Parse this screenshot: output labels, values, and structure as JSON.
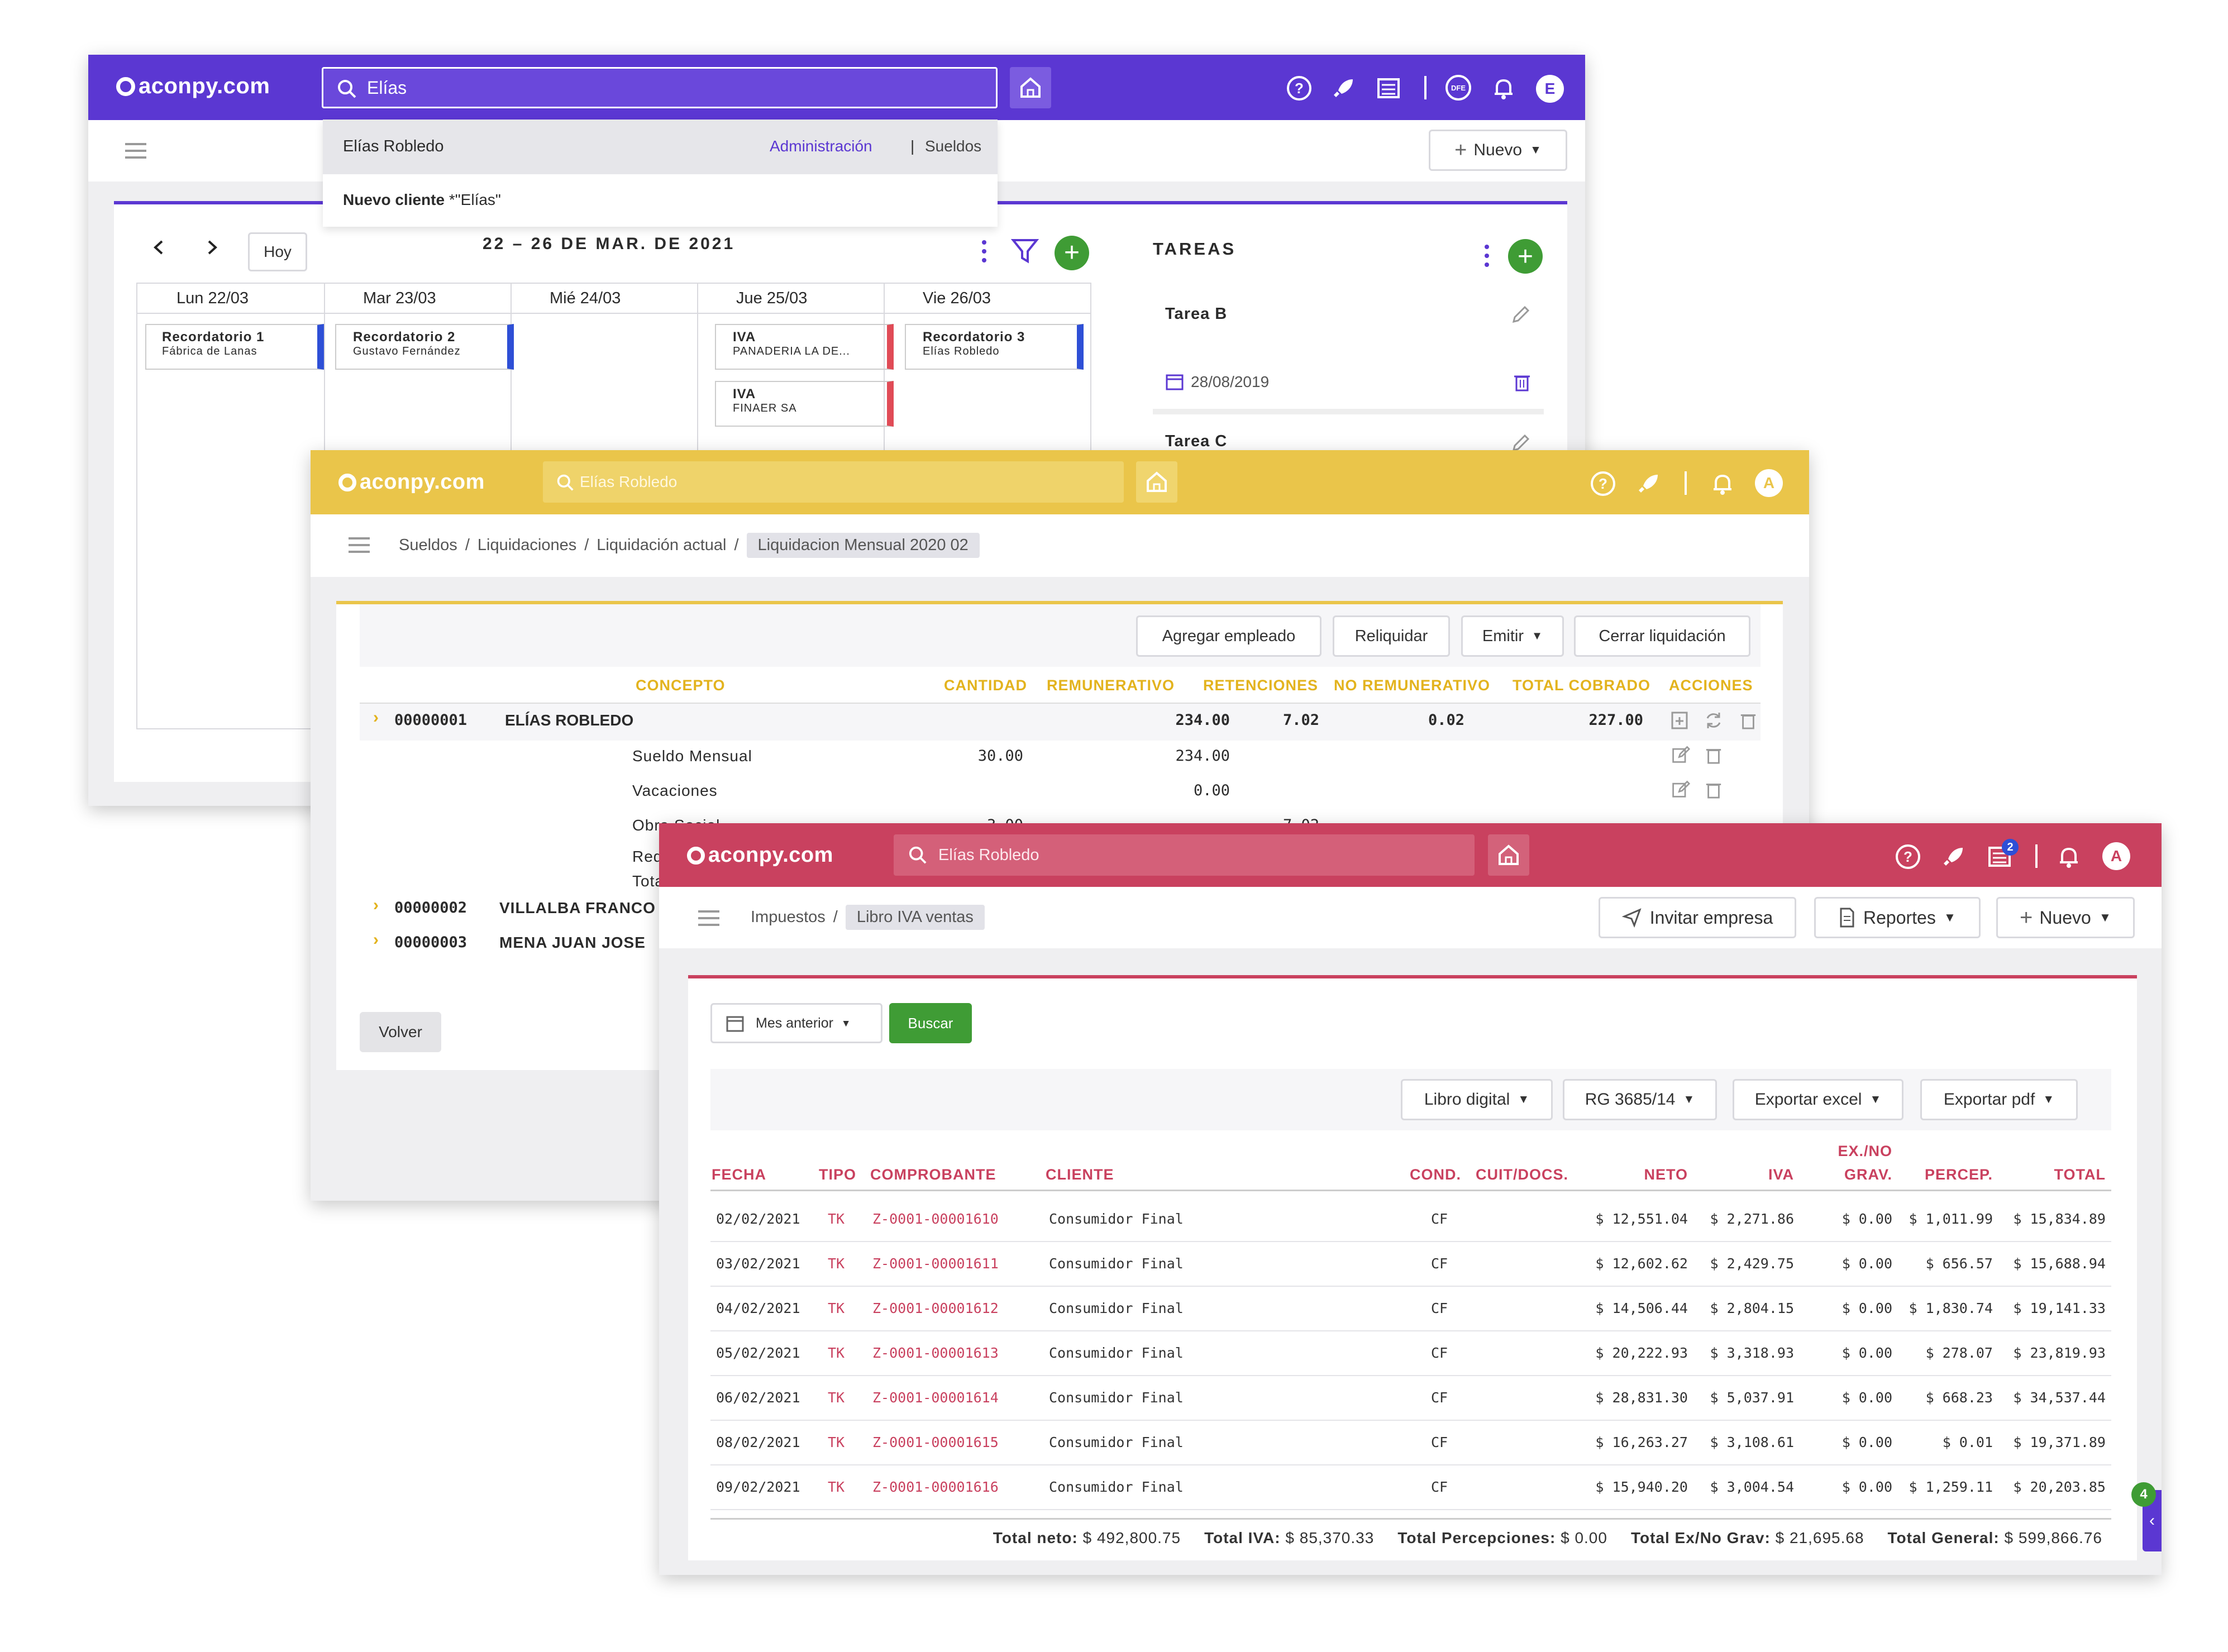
{
  "colors": {
    "purple": "#5b37d2",
    "yellow": "#eac54a",
    "crimson": "#c9415f",
    "green": "#3f9c35",
    "blue_marker": "#2e4fd6",
    "red_marker": "#e04b56",
    "link_red": "#c9415f"
  },
  "win1": {
    "logo": "aconpy.com",
    "search_value": "Elías",
    "avatar_letter": "E",
    "dfe_badge": "DFE",
    "dropdown": {
      "result_name": "Elías Robledo",
      "result_tag1": "Administración",
      "result_sep": "|",
      "result_tag2": "Sueldos",
      "new_client_bold": "Nuevo cliente",
      "new_client_rest": " *\"Elías\""
    },
    "nuevo_button": "Nuevo",
    "calendar": {
      "hoy_button": "Hoy",
      "range_title": "22 – 26 DE MAR. DE 2021",
      "days": [
        "Lun 22/03",
        "Mar 23/03",
        "Mié 24/03",
        "Jue 25/03",
        "Vie 26/03"
      ],
      "events": [
        {
          "title": "Recordatorio 1",
          "sub": "Fábrica de Lanas"
        },
        {
          "title": "Recordatorio 2",
          "sub": "Gustavo Fernández"
        },
        {
          "title": "IVA",
          "sub": "PANADERIA LA DE..."
        },
        {
          "title": "IVA",
          "sub": "FINAER SA"
        },
        {
          "title": "Recordatorio 3",
          "sub": "Elías Robledo"
        }
      ]
    },
    "tareas": {
      "title": "TAREAS",
      "task_b": "Tarea B",
      "task_b_date": "28/08/2019",
      "task_c": "Tarea C"
    }
  },
  "win2": {
    "logo": "aconpy.com",
    "search_placeholder": "Elías Robledo",
    "avatar_letter": "A",
    "breadcrumb": [
      "Sueldos",
      "Liquidaciones",
      "Liquidación actual"
    ],
    "breadcrumb_sep": "/",
    "breadcrumb_current": "Liquidacion Mensual 2020 02",
    "buttons": {
      "agregar": "Agregar empleado",
      "reliquidar": "Reliquidar",
      "emitir": "Emitir",
      "cerrar": "Cerrar liquidación",
      "volver": "Volver"
    },
    "columns": [
      "CONCEPTO",
      "CANTIDAD",
      "REMUNERATIVO",
      "RETENCIONES",
      "NO REMUNERATIVO",
      "TOTAL COBRADO",
      "ACCIONES"
    ],
    "employee1": {
      "code": "00000001",
      "name": "ELÍAS ROBLEDO",
      "remunerativo": "234.00",
      "retenciones": "7.02",
      "no_rem": "0.02",
      "total": "227.00"
    },
    "concepts": [
      {
        "name": "Sueldo Mensual",
        "cantidad": "30.00",
        "remunerativo": "234.00",
        "retenciones": ""
      },
      {
        "name": "Vacaciones",
        "cantidad": "",
        "remunerativo": "0.00",
        "retenciones": ""
      },
      {
        "name": "Obra Social",
        "cantidad": "3.00",
        "remunerativo": "",
        "retenciones": "7.02"
      },
      {
        "name": "Red",
        "cantidad": "",
        "remunerativo": "",
        "retenciones": ""
      },
      {
        "name": "Tota",
        "cantidad": "",
        "remunerativo": "",
        "retenciones": ""
      }
    ],
    "employee2": {
      "code": "00000002",
      "name": "VILLALBA FRANCO"
    },
    "employee3": {
      "code": "00000003",
      "name": "MENA JUAN JOSE"
    }
  },
  "win3": {
    "logo": "aconpy.com",
    "search_placeholder": "Elías Robledo",
    "avatar_letter": "A",
    "notif_count": "2",
    "breadcrumb_root": "Impuestos",
    "breadcrumb_sep": "/",
    "breadcrumb_current": "Libro IVA ventas",
    "top_buttons": {
      "invitar": "Invitar empresa",
      "reportes": "Reportes",
      "nuevo": "Nuevo"
    },
    "period_select": "Mes anterior",
    "buscar_button": "Buscar",
    "toolbar": {
      "libro": "Libro digital",
      "rg": "RG 3685/14",
      "excel": "Exportar excel",
      "pdf": "Exportar pdf"
    },
    "columns": {
      "fecha": "FECHA",
      "tipo": "TIPO",
      "comprobante": "COMPROBANTE",
      "cliente": "CLIENTE",
      "cond": "COND.",
      "cuit": "CUIT/DOCS.",
      "neto": "NETO",
      "iva": "IVA",
      "exno_1": "EX./NO",
      "exno_2": "GRAV.",
      "percep": "PERCEP.",
      "total": "TOTAL"
    },
    "rows": [
      {
        "fecha": "02/02/2021",
        "tipo": "TK",
        "comprobante": "Z-0001-00001610",
        "cliente": "Consumidor Final",
        "cond": "CF",
        "neto": "$ 12,551.04",
        "iva": "$ 2,271.86",
        "exno": "$ 0.00",
        "percep": "$ 1,011.99",
        "total": "$ 15,834.89"
      },
      {
        "fecha": "03/02/2021",
        "tipo": "TK",
        "comprobante": "Z-0001-00001611",
        "cliente": "Consumidor Final",
        "cond": "CF",
        "neto": "$ 12,602.62",
        "iva": "$ 2,429.75",
        "exno": "$ 0.00",
        "percep": "$ 656.57",
        "total": "$ 15,688.94"
      },
      {
        "fecha": "04/02/2021",
        "tipo": "TK",
        "comprobante": "Z-0001-00001612",
        "cliente": "Consumidor Final",
        "cond": "CF",
        "neto": "$ 14,506.44",
        "iva": "$ 2,804.15",
        "exno": "$ 0.00",
        "percep": "$ 1,830.74",
        "total": "$ 19,141.33"
      },
      {
        "fecha": "05/02/2021",
        "tipo": "TK",
        "comprobante": "Z-0001-00001613",
        "cliente": "Consumidor Final",
        "cond": "CF",
        "neto": "$ 20,222.93",
        "iva": "$ 3,318.93",
        "exno": "$ 0.00",
        "percep": "$ 278.07",
        "total": "$ 23,819.93"
      },
      {
        "fecha": "06/02/2021",
        "tipo": "TK",
        "comprobante": "Z-0001-00001614",
        "cliente": "Consumidor Final",
        "cond": "CF",
        "neto": "$ 28,831.30",
        "iva": "$ 5,037.91",
        "exno": "$ 0.00",
        "percep": "$ 668.23",
        "total": "$ 34,537.44"
      },
      {
        "fecha": "08/02/2021",
        "tipo": "TK",
        "comprobante": "Z-0001-00001615",
        "cliente": "Consumidor Final",
        "cond": "CF",
        "neto": "$ 16,263.27",
        "iva": "$ 3,108.61",
        "exno": "$ 0.00",
        "percep": "$ 0.01",
        "total": "$ 19,371.89"
      },
      {
        "fecha": "09/02/2021",
        "tipo": "TK",
        "comprobante": "Z-0001-00001616",
        "cliente": "Consumidor Final",
        "cond": "CF",
        "neto": "$ 15,940.20",
        "iva": "$ 3,004.54",
        "exno": "$ 0.00",
        "percep": "$ 1,259.11",
        "total": "$ 20,203.85"
      }
    ],
    "totals": {
      "neto_label": "Total neto:",
      "neto_value": " $ 492,800.75",
      "iva_label": "Total IVA:",
      "iva_value": " $ 85,370.33",
      "percep_label": "Total Percepciones:",
      "percep_value": " $ 0.00",
      "exno_label": "Total Ex/No Grav:",
      "exno_value": " $ 21,695.68",
      "general_label": "Total General:",
      "general_value": " $ 599,866.76"
    },
    "side_badge": "4"
  }
}
